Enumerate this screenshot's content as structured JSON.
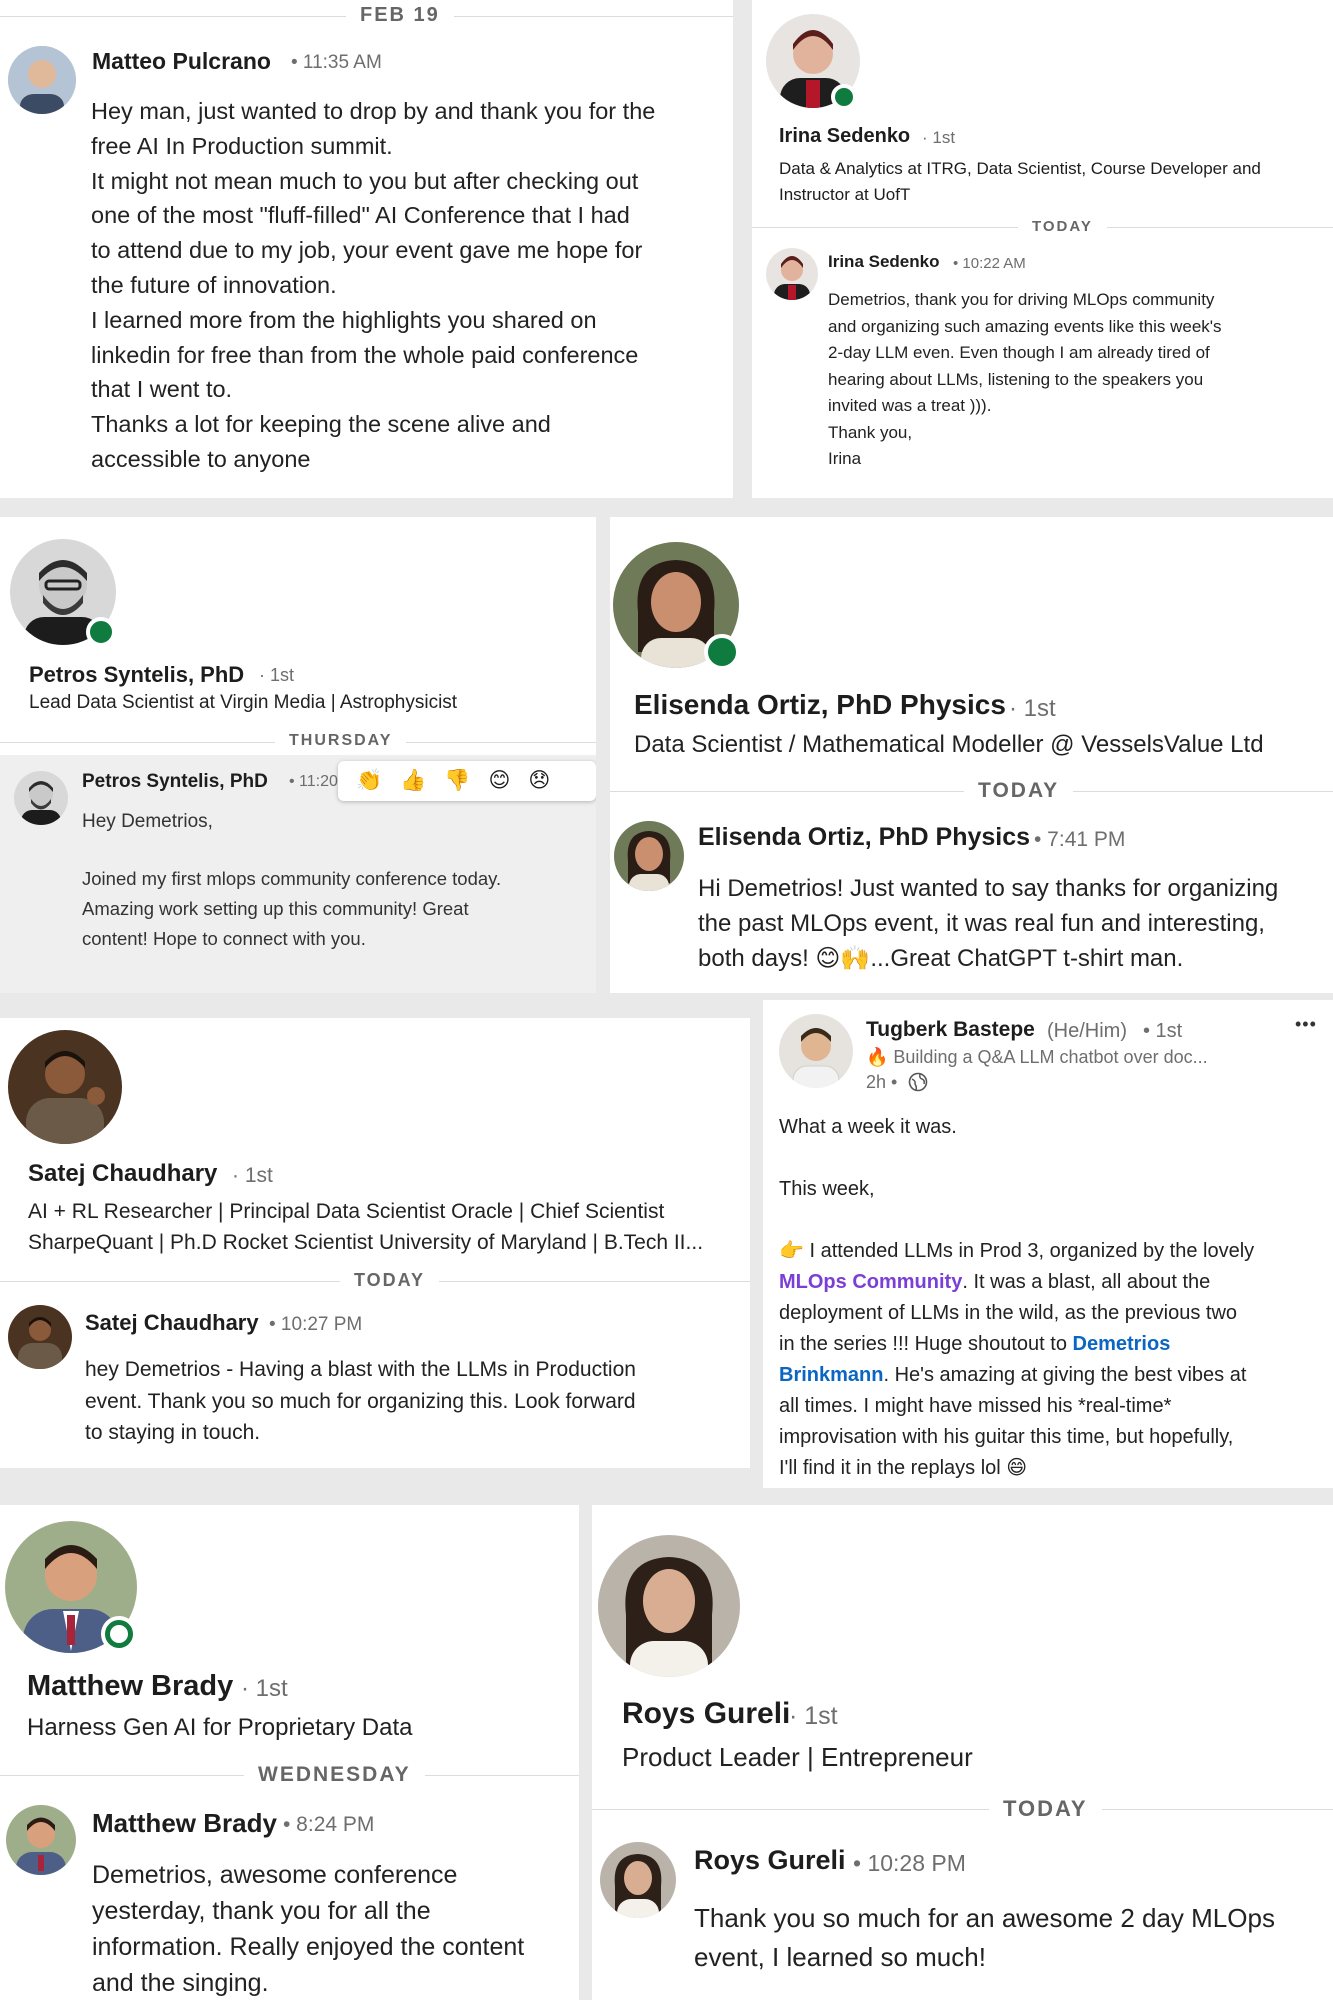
{
  "p1": {
    "day": "FEB 19",
    "name": "Matteo Pulcrano",
    "time": "• 11:35 AM",
    "lines": [
      "Hey man, just wanted to drop by and thank you for the",
      "free AI In Production summit.",
      "It might not mean much to you but after checking out",
      "one of the most \"fluff-filled\" AI Conference that I had",
      "to attend due to my job, your event gave me hope for",
      "the future of innovation.",
      "I learned more from the highlights you shared on",
      "linkedin for free than from the whole paid conference",
      "that I went to.",
      "Thanks a lot for keeping the scene alive and",
      "accessible to anyone"
    ]
  },
  "p2": {
    "name": "Irina Sedenko",
    "degree": "· 1st",
    "headline1": "Data & Analytics at ITRG, Data Scientist, Course Developer and",
    "headline2": "Instructor at UofT",
    "day": "TODAY",
    "msg_name": "Irina Sedenko",
    "time": "• 10:22 AM",
    "lines": [
      "Demetrios, thank you for driving MLOps community",
      "and organizing such amazing events like this week's",
      "2-day LLM even. Even though I am already tired of",
      "hearing about LLMs, listening to the speakers you",
      "invited was a treat ))).",
      "Thank you,",
      "Irina"
    ]
  },
  "p3": {
    "name": "Petros Syntelis, PhD",
    "degree": "· 1st",
    "headline": "Lead Data Scientist at Virgin Media | Astrophysicist",
    "day": "THURSDAY",
    "msg_name": "Petros Syntelis, PhD",
    "time": "• 11:20",
    "reactions": [
      "👏",
      "👍",
      "👎",
      "😊",
      "😞"
    ],
    "greeting": "Hey Demetrios,",
    "lines": [
      "Joined my first mlops community conference today.",
      "Amazing work setting up this community! Great",
      "content! Hope to connect with you."
    ]
  },
  "p4": {
    "name": "Elisenda Ortiz, PhD Physics",
    "degree": "· 1st",
    "headline": "Data Scientist / Mathematical Modeller @ VesselsValue Ltd",
    "day": "TODAY",
    "msg_name": "Elisenda Ortiz, PhD Physics",
    "time": "• 7:41 PM",
    "lines": [
      "Hi Demetrios! Just wanted to say thanks for organizing",
      "the past MLOps event, it was real fun and interesting,",
      "both days! 😊🙌...Great ChatGPT t-shirt man."
    ]
  },
  "p5": {
    "name": "Satej Chaudhary",
    "degree": "· 1st",
    "headline1": "AI + RL Researcher | Principal Data Scientist Oracle | Chief Scientist",
    "headline2": "SharpeQuant | Ph.D Rocket Scientist University of Maryland | B.Tech II...",
    "day": "TODAY",
    "msg_name": "Satej Chaudhary",
    "time": "• 10:27 PM",
    "lines": [
      "hey Demetrios - Having a blast with the LLMs in Production",
      "event. Thank you so much for organizing this. Look forward",
      "to staying in touch."
    ]
  },
  "p6": {
    "name": "Tugberk Bastepe",
    "pronouns": "(He/Him)",
    "degree": "• 1st",
    "headline": "🔥 Building a Q&A LLM chatbot over doc...",
    "age": "2h •",
    "more": "•••",
    "l1": "What a week it was.",
    "l2": "This week,",
    "l3a": "👉 I attended LLMs in Prod 3, organized by the lovely",
    "l3b_link": "MLOps Community",
    "l3b_rest": ". It was a blast, all about the",
    "l3c": "deployment of LLMs in the wild, as the previous two",
    "l3d": "in the series !!! Huge shoutout to ",
    "l3d_link": "Demetrios",
    "l3e_link": "Brinkmann",
    "l3e_rest": ". He's amazing at giving the best vibes at",
    "l3f": "all times. I might have missed his *real-time*",
    "l3g": "improvisation with his guitar this time, but hopefully,",
    "l3h": "I'll find it in the replays lol 😄"
  },
  "p7": {
    "name": "Matthew Brady",
    "degree": "· 1st",
    "headline": "Harness Gen AI for Proprietary Data",
    "day": "WEDNESDAY",
    "msg_name": "Matthew Brady",
    "time": "• 8:24 PM",
    "lines": [
      "Demetrios, awesome conference",
      "yesterday, thank you for all the",
      "information. Really enjoyed the content",
      "and the singing."
    ]
  },
  "p8": {
    "name": "Roys Gureli",
    "degree": "· 1st",
    "headline": "Product Leader | Entrepreneur",
    "day": "TODAY",
    "msg_name": "Roys Gureli",
    "time": "• 10:28 PM",
    "lines": [
      "Thank you so much for an awesome 2 day MLOps",
      "event, I learned so much!"
    ]
  },
  "colors": {
    "online": "#0f7b3e",
    "link": "#0a66c2",
    "community": "#7b3fd6"
  }
}
